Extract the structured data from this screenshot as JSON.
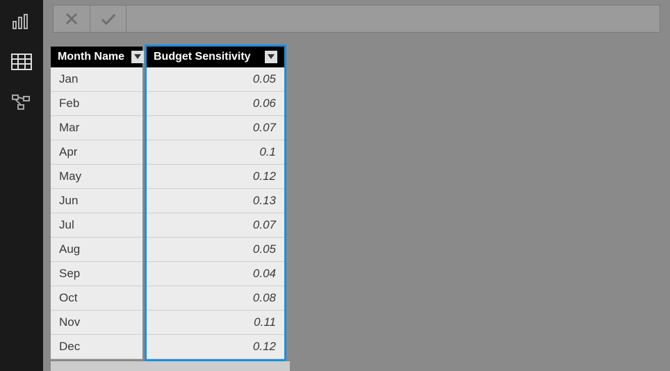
{
  "sidebar": {
    "items": [
      {
        "name": "report-view-icon"
      },
      {
        "name": "data-view-icon"
      },
      {
        "name": "model-view-icon"
      }
    ]
  },
  "formulaBar": {
    "cancel": "",
    "confirm": "",
    "value": ""
  },
  "table": {
    "columns": [
      {
        "header": "Month Name",
        "selected": false
      },
      {
        "header": "Budget Sensitivity",
        "selected": true
      }
    ],
    "rows": [
      {
        "month": "Jan",
        "sensitivity": "0.05"
      },
      {
        "month": "Feb",
        "sensitivity": "0.06"
      },
      {
        "month": "Mar",
        "sensitivity": "0.07"
      },
      {
        "month": "Apr",
        "sensitivity": "0.1"
      },
      {
        "month": "May",
        "sensitivity": "0.12"
      },
      {
        "month": "Jun",
        "sensitivity": "0.13"
      },
      {
        "month": "Jul",
        "sensitivity": "0.07"
      },
      {
        "month": "Aug",
        "sensitivity": "0.05"
      },
      {
        "month": "Sep",
        "sensitivity": "0.04"
      },
      {
        "month": "Oct",
        "sensitivity": "0.08"
      },
      {
        "month": "Nov",
        "sensitivity": "0.11"
      },
      {
        "month": "Dec",
        "sensitivity": "0.12"
      }
    ]
  }
}
